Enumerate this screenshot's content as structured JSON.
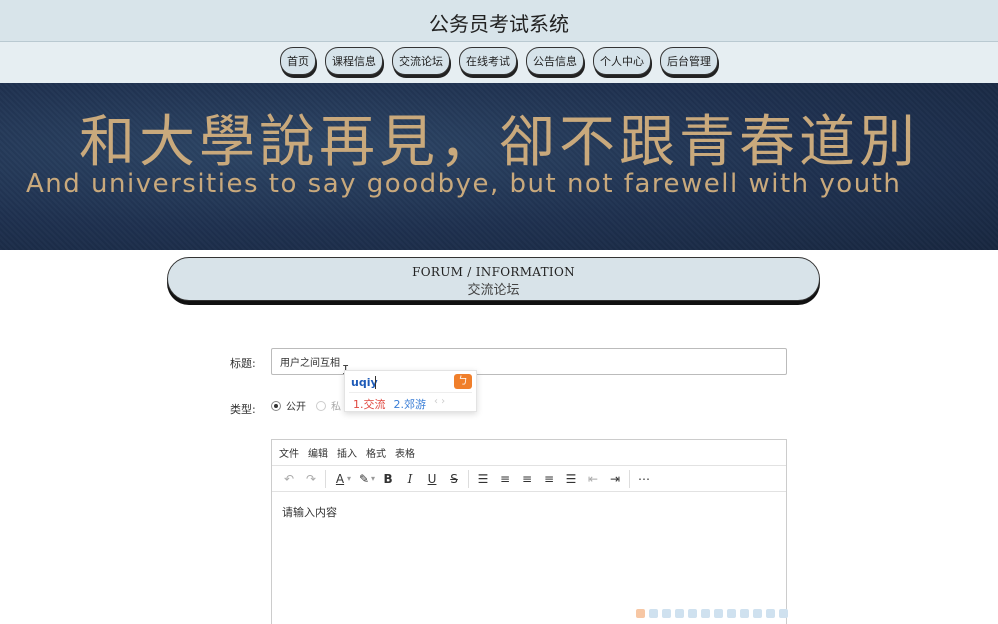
{
  "header": {
    "title": "公务员考试系统"
  },
  "nav": {
    "items": [
      "首页",
      "课程信息",
      "交流论坛",
      "在线考试",
      "公告信息",
      "个人中心",
      "后台管理"
    ]
  },
  "banner": {
    "headline": "和大學說再見，卻不跟青春道別",
    "subline": "And universities to say goodbye, but not farewell with youth"
  },
  "section": {
    "title_en": "FORUM / INFORMATION",
    "title_cn": "交流论坛"
  },
  "form": {
    "title_label": "标题:",
    "title_value": "用户之间互相",
    "type_label": "类型:",
    "type_options": [
      "公开",
      "私"
    ],
    "type_selected": "公开"
  },
  "ime": {
    "composition": "uqiy",
    "candidates": [
      "1.交流",
      "2.郊游"
    ],
    "arrows": "‹ ›"
  },
  "editor": {
    "menus": [
      "文件",
      "编辑",
      "插入",
      "格式",
      "表格"
    ],
    "placeholder": "请输入内容",
    "toolbar_icons": [
      "undo-icon",
      "redo-icon",
      "text-color-icon",
      "highlight-icon",
      "bold-icon",
      "italic-icon",
      "underline-icon",
      "strikethrough-icon",
      "list-icon",
      "align-left-icon",
      "align-center-icon",
      "align-right-icon",
      "align-justify-icon",
      "outdent-icon",
      "indent-icon",
      "more-icon"
    ]
  }
}
